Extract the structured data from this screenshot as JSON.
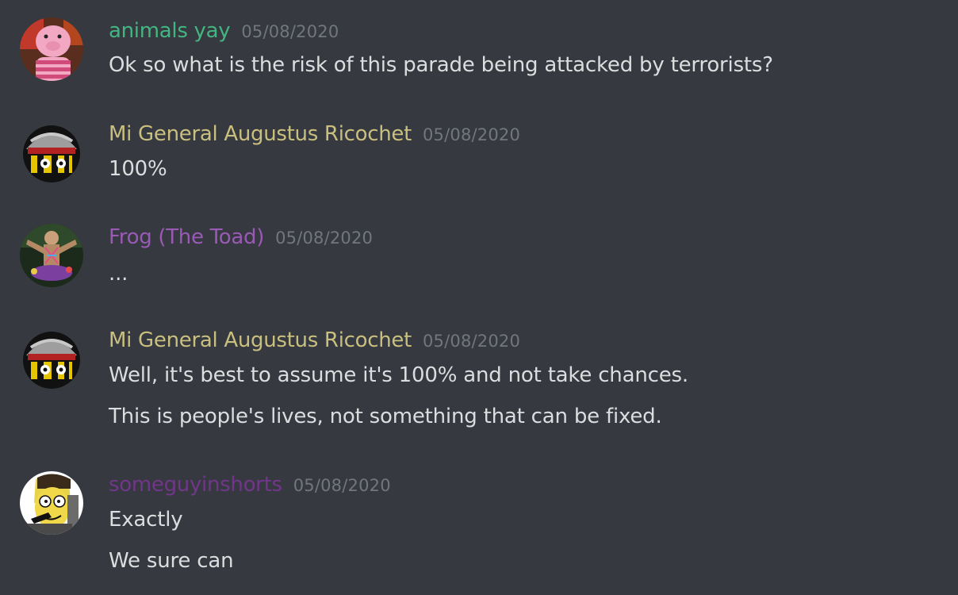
{
  "messages": [
    {
      "username": "animals yay",
      "color": "#43b581",
      "timestamp": "05/08/2020",
      "avatar": "pink-pig-avatar",
      "lines": [
        "Ok so what is the risk of this parade being attacked by terrorists?"
      ]
    },
    {
      "username": "Mi General Augustus Ricochet",
      "color": "#c9bf7e",
      "timestamp": "05/08/2020",
      "avatar": "soldier-ball-avatar",
      "lines": [
        "100%"
      ]
    },
    {
      "username": "Frog (The Toad)",
      "color": "#9b59b6",
      "timestamp": "05/08/2020",
      "avatar": "painted-figure-avatar",
      "lines": [
        "..."
      ]
    },
    {
      "username": "Mi General Augustus Ricochet",
      "color": "#c9bf7e",
      "timestamp": "05/08/2020",
      "avatar": "soldier-ball-avatar",
      "lines": [
        "Well, it's best to assume it's 100% and not take chances.",
        "This is people's lives, not something that can be fixed."
      ]
    },
    {
      "username": "someguyinshorts",
      "color": "#71368a",
      "timestamp": "05/08/2020",
      "avatar": "cartoon-man-avatar",
      "lines": [
        "Exactly",
        "We sure can"
      ]
    }
  ]
}
